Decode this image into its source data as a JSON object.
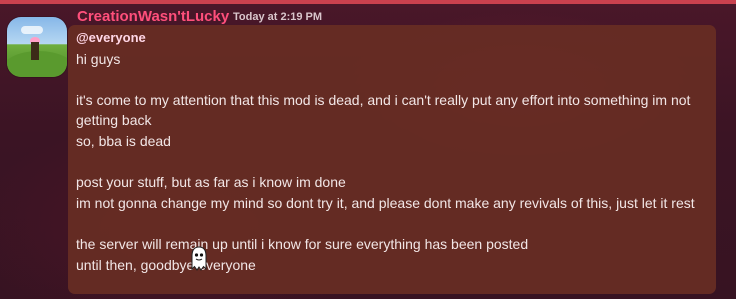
{
  "message": {
    "author": "CreationWasn'tLucky",
    "timestamp": "Today at 2:19 PM",
    "mention": "@everyone",
    "lines": [
      "hi guys",
      "",
      "it's come to my attention that this mod is dead, and i can't really put any effort into something im not getting back",
      "so, bba is dead",
      "",
      "post your stuff, but as far as i know im done",
      "im not gonna change my mind so dont try it, and please dont make any revivals of this, just let it rest",
      "",
      "the server will remain up until i know for sure everything has been posted",
      "until then, goodbye everyone"
    ]
  },
  "icons": {
    "avatar": "landscape-avatar-icon",
    "cursor": "ghost-cursor-icon"
  },
  "colors": {
    "username": "#ff4f7b",
    "bubble": "#672d23",
    "background": "#3a1420",
    "accent_strip": "#c9414e"
  }
}
